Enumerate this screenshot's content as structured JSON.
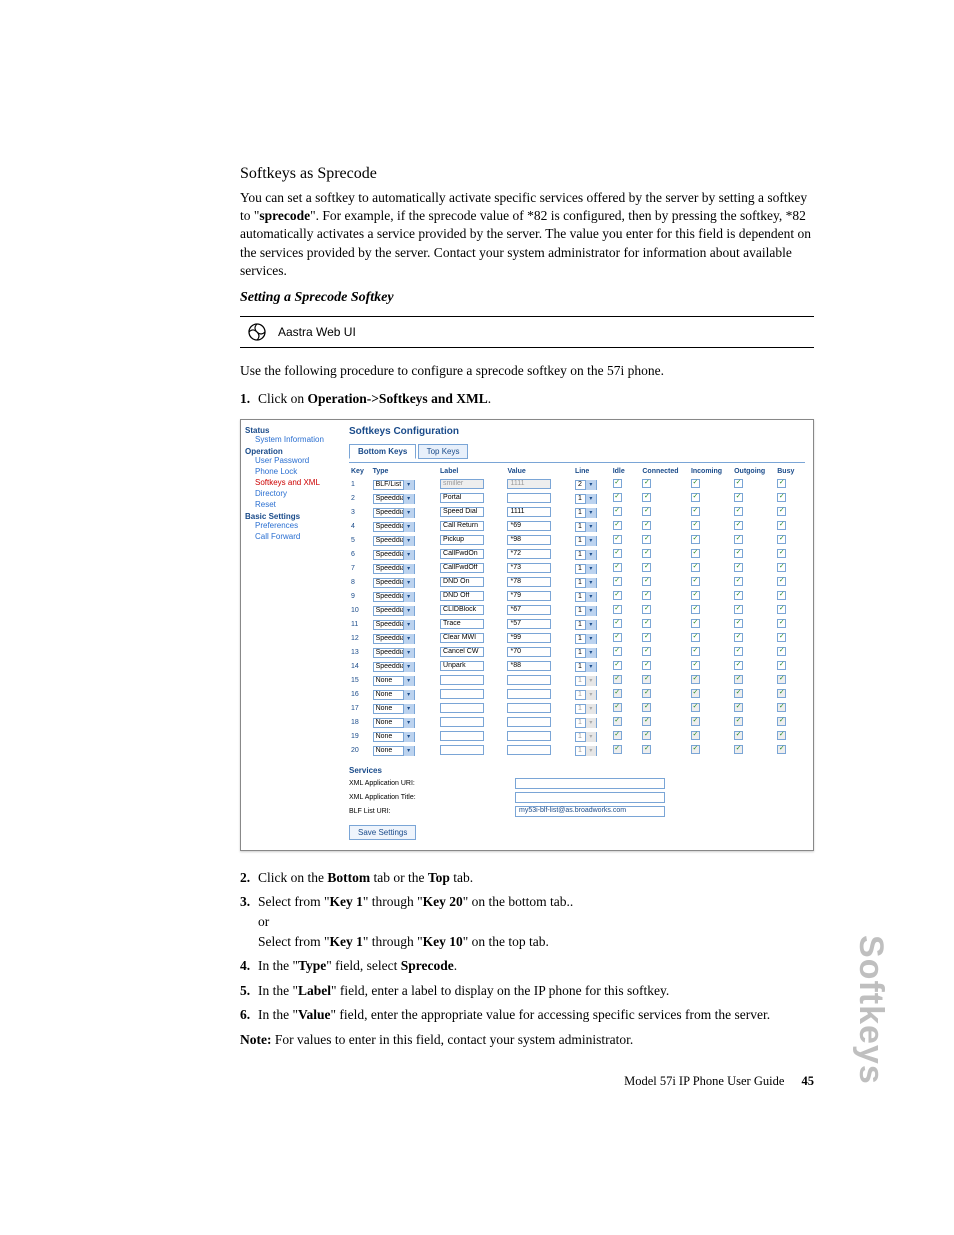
{
  "section_title": "Softkeys as Sprecode",
  "intro_html": "You can set a softkey to automatically activate specific services offered by the server by setting a softkey to \"<b>sprecode</b>\". For example, if the sprecode value of *82 is configured, then by pressing the softkey, *82 automatically activates a service provided by the server. The value you enter for this field is dependent on the services provided by the server. Contact your system administrator for information about available services.",
  "subsection_title": "Setting a Sprecode Softkey",
  "webui_label": "Aastra Web UI",
  "use_following": "Use the following procedure to configure a sprecode softkey on the 57i phone.",
  "steps": [
    "Click on <b>Operation->Softkeys and XML</b>.",
    "Click on the <b>Bottom</b> tab or the <b>Top</b> tab.",
    "Select from \"<b>Key 1</b>\" through \"<b>Key 20</b>\" on the bottom tab..<span class=\"or\">or</span>Select from \"<b>Key 1</b>\" through \"<b>Key 10</b>\" on the top tab.",
    "In the \"<b>Type</b>\" field, select <b>Sprecode</b>.",
    "In the \"<b>Label</b>\" field, enter a label to display on the IP phone for this softkey.",
    "In the \"<b>Value</b>\" field, enter the appropriate value for accessing specific services from the server."
  ],
  "note_line": "<b>Note:</b> For values to enter in this field, contact your system administrator.",
  "footer_text": "Model 57i IP Phone User Guide",
  "footer_page": "45",
  "side_tab": "Softkeys",
  "config": {
    "pane_title": "Softkeys Configuration",
    "sidebar": {
      "status": {
        "header": "Status",
        "items": [
          "System Information"
        ]
      },
      "operation": {
        "header": "Operation",
        "items": [
          "User Password",
          "Phone Lock",
          "Softkeys and XML",
          "Directory",
          "Reset"
        ]
      },
      "basic": {
        "header": "Basic Settings",
        "items": [
          "Preferences",
          "Call Forward"
        ]
      }
    },
    "tabs": {
      "bottom": "Bottom Keys",
      "top": "Top Keys"
    },
    "columns": [
      "Key",
      "Type",
      "Label",
      "Value",
      "Line",
      "Idle",
      "Connected",
      "Incoming",
      "Outgoing",
      "Busy"
    ],
    "rows": [
      {
        "key": 1,
        "type": "BLF/List",
        "label": "smiller",
        "labelDis": true,
        "value": "1111",
        "valueDis": true,
        "line": "2",
        "states": true
      },
      {
        "key": 2,
        "type": "Speeddial",
        "label": "Portal",
        "value": "",
        "line": "1",
        "states": true
      },
      {
        "key": 3,
        "type": "Speeddial",
        "label": "Speed Dial",
        "value": "1111",
        "line": "1",
        "states": true
      },
      {
        "key": 4,
        "type": "Speeddial",
        "label": "Call Return",
        "value": "*69",
        "line": "1",
        "states": true
      },
      {
        "key": 5,
        "type": "Speeddial",
        "label": "Pickup",
        "value": "*98",
        "line": "1",
        "states": true
      },
      {
        "key": 6,
        "type": "Speeddial",
        "label": "CallFwdOn",
        "value": "*72",
        "line": "1",
        "states": true
      },
      {
        "key": 7,
        "type": "Speeddial",
        "label": "CallFwdOff",
        "value": "*73",
        "line": "1",
        "states": true
      },
      {
        "key": 8,
        "type": "Speeddial",
        "label": "DND On",
        "value": "*78",
        "line": "1",
        "states": true
      },
      {
        "key": 9,
        "type": "Speeddial",
        "label": "DND Off",
        "value": "*79",
        "line": "1",
        "states": true
      },
      {
        "key": 10,
        "type": "Speeddial",
        "label": "CLIDBlock",
        "value": "*67",
        "line": "1",
        "states": true
      },
      {
        "key": 11,
        "type": "Speeddial",
        "label": "Trace",
        "value": "*57",
        "line": "1",
        "states": true
      },
      {
        "key": 12,
        "type": "Speeddial",
        "label": "Clear MWI",
        "value": "*99",
        "line": "1",
        "states": true
      },
      {
        "key": 13,
        "type": "Speeddial",
        "label": "Cancel CW",
        "value": "*70",
        "line": "1",
        "states": true
      },
      {
        "key": 14,
        "type": "Speeddial",
        "label": "Unpark",
        "value": "*88",
        "line": "1",
        "states": true
      },
      {
        "key": 15,
        "type": "None",
        "label": "",
        "value": "",
        "line": "1",
        "lineDis": true,
        "states": false
      },
      {
        "key": 16,
        "type": "None",
        "label": "",
        "value": "",
        "line": "1",
        "lineDis": true,
        "states": false
      },
      {
        "key": 17,
        "type": "None",
        "label": "",
        "value": "",
        "line": "1",
        "lineDis": true,
        "states": false
      },
      {
        "key": 18,
        "type": "None",
        "label": "",
        "value": "",
        "line": "1",
        "lineDis": true,
        "states": false
      },
      {
        "key": 19,
        "type": "None",
        "label": "",
        "value": "",
        "line": "1",
        "lineDis": true,
        "states": false
      },
      {
        "key": 20,
        "type": "None",
        "label": "",
        "value": "",
        "line": "1",
        "lineDis": true,
        "states": false
      }
    ],
    "services": {
      "header": "Services",
      "xml_uri": {
        "label": "XML Application URI:",
        "value": ""
      },
      "xml_title": {
        "label": "XML Application Title:",
        "value": ""
      },
      "blf_uri": {
        "label": "BLF List URI:",
        "value": "my53i-blf-list@as.broadworks.com"
      }
    },
    "save_label": "Save Settings"
  }
}
